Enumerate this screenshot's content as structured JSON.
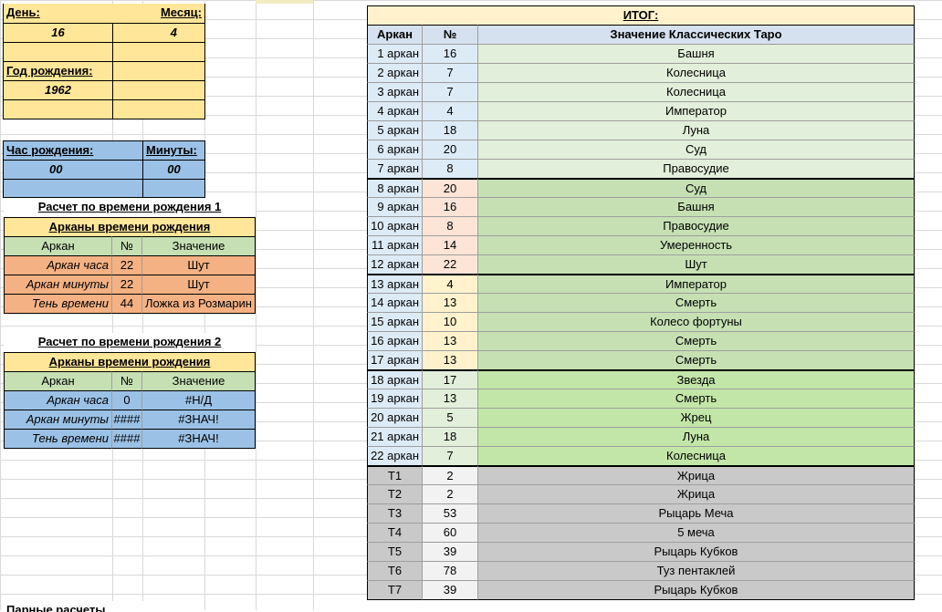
{
  "birth": {
    "day_label": "День:",
    "month_label": "Месяц:",
    "day_value": "16",
    "month_value": "4",
    "year_label": "Год рождения:",
    "year_value": "1962",
    "hour_label": "Час рождения:",
    "minutes_label": "Минуты:",
    "hour_value": "00",
    "minutes_value": "00"
  },
  "calc1": {
    "title": "Расчет по времени рождения 1",
    "header": "Арканы времени рождения",
    "col_arcana": "Аркан",
    "col_num": "№",
    "col_meaning": "Значение",
    "rows": [
      {
        "label": "Аркан часа",
        "num": "22",
        "meaning": "Шут"
      },
      {
        "label": "Аркан минуты",
        "num": "22",
        "meaning": "Шут"
      },
      {
        "label": "Тень времени",
        "num": "44",
        "meaning": "Ложка из Розмарин"
      }
    ]
  },
  "calc2": {
    "title": "Расчет по времени рождения 2",
    "header": "Арканы времени рождения",
    "col_arcana": "Аркан",
    "col_num": "№",
    "col_meaning": "Значение",
    "rows": [
      {
        "label": "Аркан часа",
        "num": "0",
        "meaning": "#Н/Д"
      },
      {
        "label": "Аркан минуты",
        "num": "####",
        "meaning": "#ЗНАЧ!"
      },
      {
        "label": "Тень времени",
        "num": "####",
        "meaning": "#ЗНАЧ!"
      }
    ]
  },
  "bottom_text": "Парные расчеты",
  "result": {
    "title": "ИТОГ:",
    "col_arcana": "Аркан",
    "col_num": "№",
    "col_meaning": "Значение Классических Таро",
    "rows": [
      {
        "label": "1 аркан",
        "num": "16",
        "meaning": "Башня"
      },
      {
        "label": "2 аркан",
        "num": "7",
        "meaning": "Колесница"
      },
      {
        "label": "3 аркан",
        "num": "7",
        "meaning": "Колесница"
      },
      {
        "label": "4 аркан",
        "num": "4",
        "meaning": "Император"
      },
      {
        "label": "5 аркан",
        "num": "18",
        "meaning": "Луна"
      },
      {
        "label": "6 аркан",
        "num": "20",
        "meaning": "Суд"
      },
      {
        "label": "7 аркан",
        "num": "8",
        "meaning": "Правосудие"
      },
      {
        "label": "8 аркан",
        "num": "20",
        "meaning": "Суд"
      },
      {
        "label": "9 аркан",
        "num": "16",
        "meaning": "Башня"
      },
      {
        "label": "10 аркан",
        "num": "8",
        "meaning": "Правосудие"
      },
      {
        "label": "11 аркан",
        "num": "14",
        "meaning": "Умеренность"
      },
      {
        "label": "12 аркан",
        "num": "22",
        "meaning": "Шут"
      },
      {
        "label": "13 аркан",
        "num": "4",
        "meaning": "Император"
      },
      {
        "label": "14 аркан",
        "num": "13",
        "meaning": "Смерть"
      },
      {
        "label": "15 аркан",
        "num": "10",
        "meaning": "Колесо фортуны"
      },
      {
        "label": "16 аркан",
        "num": "13",
        "meaning": "Смерть"
      },
      {
        "label": "17 аркан",
        "num": "13",
        "meaning": "Смерть"
      },
      {
        "label": "18 аркан",
        "num": "17",
        "meaning": "Звезда"
      },
      {
        "label": "19 аркан",
        "num": "13",
        "meaning": "Смерть"
      },
      {
        "label": "20 аркан",
        "num": "5",
        "meaning": "Жрец"
      },
      {
        "label": "21 аркан",
        "num": "18",
        "meaning": "Луна"
      },
      {
        "label": "22 аркан",
        "num": "7",
        "meaning": "Колесница"
      },
      {
        "label": "Т1",
        "num": "2",
        "meaning": "Жрица"
      },
      {
        "label": "Т2",
        "num": "2",
        "meaning": "Жрица"
      },
      {
        "label": "Т3",
        "num": "53",
        "meaning": "Рыцарь Меча"
      },
      {
        "label": "Т4",
        "num": "60",
        "meaning": "5 меча"
      },
      {
        "label": "Т5",
        "num": "39",
        "meaning": "Рыцарь Кубков"
      },
      {
        "label": "Т6",
        "num": "78",
        "meaning": "Туз пентаклей"
      },
      {
        "label": "Т7",
        "num": "39",
        "meaning": "Рыцарь Кубков"
      }
    ]
  },
  "colors": {
    "yellow": "#ffe699",
    "blue": "#9bc2e6",
    "green": "#c6e0b4",
    "orange": "#f4b183",
    "gray": "#c9c9c9"
  }
}
